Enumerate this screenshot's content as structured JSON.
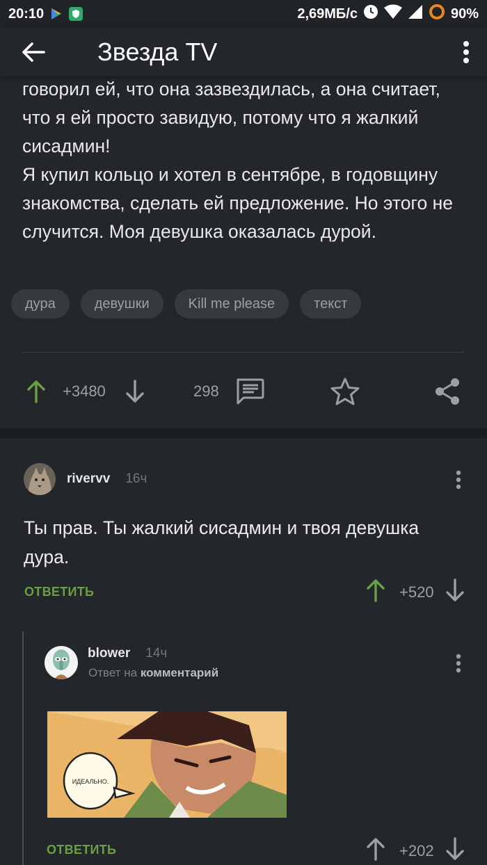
{
  "status": {
    "time": "20:10",
    "speed": "2,69МБ/с",
    "battery": "90%"
  },
  "appbar": {
    "title": "Звезда TV"
  },
  "post": {
    "paragraphs": [
      "говорил ей, что она зазвездилась, а она считает, что я ей просто завидую, потому что я жалкий сисадмин!",
      "Я купил кольцо и хотел в сентябре, в годовщину знакомства, сделать ей предложение. Но этого не случится. Моя девушка оказалась дурой."
    ],
    "tags": [
      "дура",
      "девушки",
      "Kill me please",
      "текст"
    ],
    "rating": "+3480",
    "comments_count": "298"
  },
  "comments": [
    {
      "user": "rivervv",
      "time": "16ч",
      "text": "Ты прав. Ты жалкий сисадмин и твоя девушка дура.",
      "reply_label": "ОТВЕТИТЬ",
      "rating": "+520"
    },
    {
      "user": "blower",
      "time": "14ч",
      "reply_to_prefix": "Ответ на",
      "reply_to_target": "комментарий",
      "image_caption": "ИДЕАЛЬНО.",
      "reply_label": "ОТВЕТИТЬ",
      "rating": "+202"
    }
  ],
  "colors": {
    "background": "#23272b",
    "accent_green": "#6aa042",
    "muted": "#9aa0a5"
  }
}
